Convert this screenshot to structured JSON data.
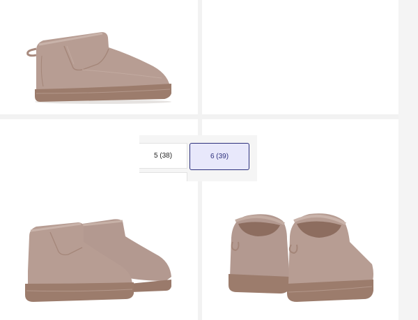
{
  "gallery": {
    "images": [
      {
        "icon": "boot-side-left-view-image"
      },
      {
        "icon": "boot-side-right-view-image"
      },
      {
        "icon": "boots-pair-front-view-image"
      },
      {
        "icon": "boots-pair-back-view-image"
      }
    ]
  },
  "size_selector": {
    "options": [
      {
        "label": "5 (38)",
        "selected": false
      },
      {
        "label": "6 (39)",
        "selected": true
      }
    ],
    "accent_color": "#2c2f7c",
    "selected_bg": "#e8e8fb"
  },
  "colors": {
    "suede": "#b79d93",
    "sole": "#9c7c6c",
    "background": "#f2f2f2"
  }
}
